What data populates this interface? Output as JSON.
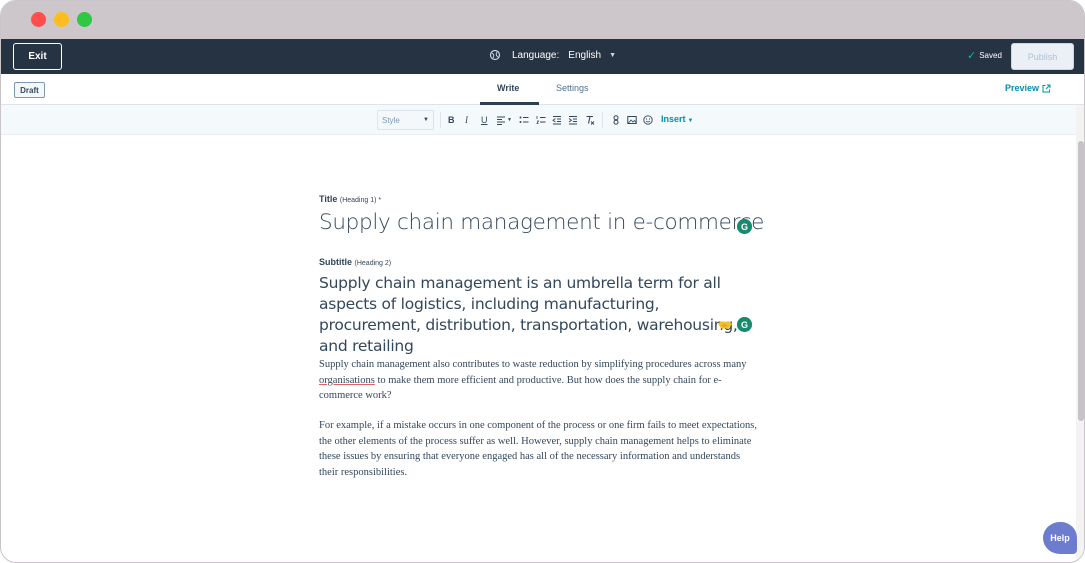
{
  "topbar": {
    "exit_label": "Exit",
    "language_label": "Language:",
    "language_value": "English",
    "saved_label": "Saved",
    "publish_label": "Publish"
  },
  "tabs": {
    "draft_badge": "Draft",
    "write": "Write",
    "settings": "Settings",
    "preview": "Preview"
  },
  "toolbar": {
    "style_placeholder": "Style",
    "insert_label": "Insert"
  },
  "editor": {
    "title_label": "Title",
    "title_hint": "(Heading 1) *",
    "title": "Supply chain management in e-commerce",
    "subtitle_label": "Subtitle",
    "subtitle_hint": "(Heading 2)",
    "subtitle": "Supply chain management is an umbrella term for all aspects of logistics, including manufacturing, procurement, distribution, transportation, warehousing, and retailing",
    "paragraph1_before": "Supply chain management also contributes to waste reduction by simplifying procedures across many ",
    "paragraph1_underlined": "organisations",
    "paragraph1_after": " to make them more efficient and productive. But how does the supply chain for e-commerce work?",
    "paragraph2": "For example, if a mistake occurs in one component of the process or one firm fails to meet expectations, the other elements of the process suffer as well. However, supply chain management helps to eliminate these issues by ensuring that everyone engaged has all of the necessary information and understands their responsibilities."
  },
  "help": {
    "label": "Help"
  },
  "colors": {
    "topbar_bg": "#253342",
    "accent_link": "#0091ae",
    "help_bg": "#6e7cce"
  }
}
